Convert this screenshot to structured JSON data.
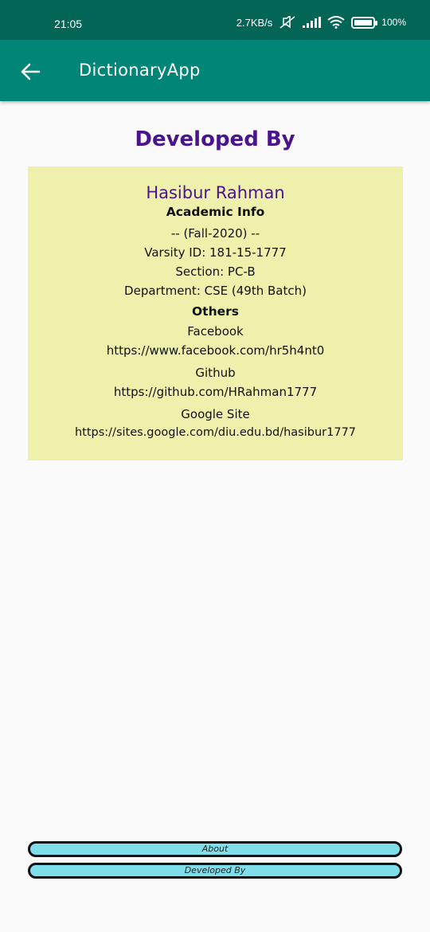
{
  "status_bar": {
    "time": "21:05",
    "network_speed": "2.7KB/s",
    "battery": "100%"
  },
  "app_bar": {
    "title": "DictionaryApp",
    "back_icon": "arrow-left-icon"
  },
  "page": {
    "heading": "Developed By"
  },
  "developer": {
    "name": "Hasibur Rahman",
    "academic_heading": "Academic Info",
    "semester": "-- (Fall-2020) --",
    "varsity_id": "Varsity ID: 181-15-1777",
    "section": "Section: PC-B",
    "department": "Department: CSE (49th Batch)",
    "others_heading": "Others",
    "facebook_label": "Facebook",
    "facebook_url": "https://www.facebook.com/hr5h4nt0",
    "github_label": "Github",
    "github_url": "https://github.com/HRahman1777",
    "google_site_label": "Google Site",
    "google_site_url": "https://sites.google.com/diu.edu.bd/hasibur1777"
  },
  "bottom_buttons": {
    "about": "About",
    "developed_by": "Developed By"
  },
  "colors": {
    "status_bar": "#036556",
    "app_bar": "#008577",
    "heading": "#4a148c",
    "card": "#eff0ac",
    "button": "#80deea"
  }
}
